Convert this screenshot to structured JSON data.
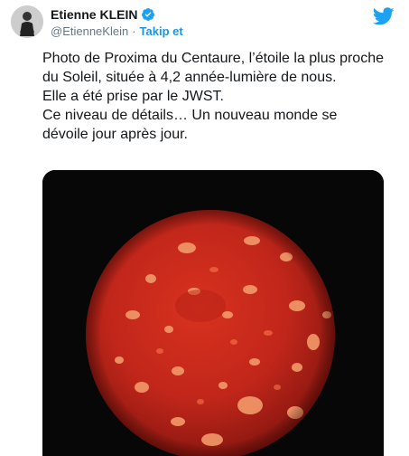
{
  "author": {
    "display_name": "Etienne KLEIN",
    "handle": "@EtienneKlein",
    "separator": "·",
    "follow_label": "Takip et",
    "verified": true,
    "avatar_icon": "user-avatar"
  },
  "brand": {
    "logo_icon": "twitter-bird-icon",
    "accent_color": "#1da1f2"
  },
  "tweet": {
    "lines": [
      "Photo de Proxima du Centaure, l’étoile la plus proche du Soleil, située à 4,2 année-lumière de nous.",
      "Elle a été prise par le JWST.",
      "Ce niveau de détails… Un nouveau monde se dévoile jour après jour."
    ]
  },
  "media": {
    "type": "photo",
    "background_color": "#070707",
    "subject_color": "#c8281e"
  }
}
